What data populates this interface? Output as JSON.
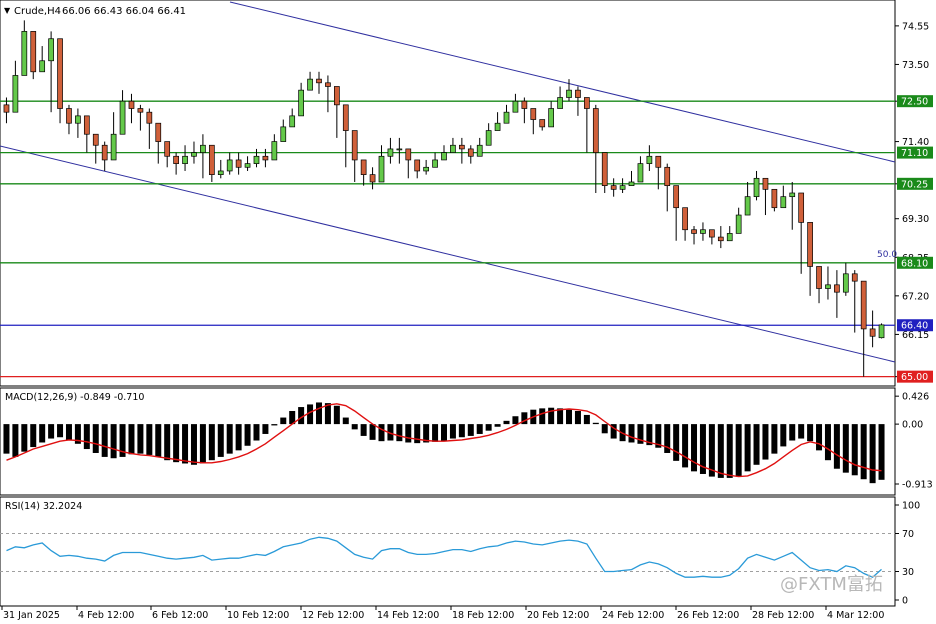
{
  "chart_data": [
    {
      "type": "candlestick",
      "symbol_header": "Crude,H4",
      "ohlc_header": "66.06 66.43 66.04 66.41",
      "y_ticks": [
        "74.55",
        "73.50",
        "72.50",
        "71.40",
        "70.25",
        "69.30",
        "68.25",
        "67.20",
        "66.15",
        "65.00"
      ],
      "ylim": [
        64.8,
        75.2
      ],
      "fib_label": "50.0",
      "h_levels": [
        {
          "value": 72.5,
          "label": "72.50",
          "color": "#1a8a1a"
        },
        {
          "value": 71.1,
          "label": "71.10",
          "color": "#1a8a1a"
        },
        {
          "value": 70.25,
          "label": "70.25",
          "color": "#1a8a1a"
        },
        {
          "value": 68.1,
          "label": "68.10",
          "color": "#1a8a1a"
        },
        {
          "value": 66.4,
          "label": "66.40",
          "color": "#2020c0"
        },
        {
          "value": 65.0,
          "label": "65.00",
          "color": "#e02020"
        }
      ],
      "channel_color": "#3030a0",
      "candles_close": [
        72.2,
        73.2,
        74.4,
        73.3,
        73.6,
        74.2,
        72.3,
        71.9,
        72.1,
        71.6,
        71.3,
        70.9,
        71.6,
        72.5,
        72.3,
        72.2,
        71.9,
        71.4,
        71.0,
        70.8,
        71.0,
        71.1,
        71.3,
        70.5,
        70.6,
        70.9,
        70.7,
        70.8,
        71.0,
        70.9,
        71.4,
        71.8,
        72.1,
        72.8,
        73.1,
        73.0,
        72.9,
        72.4,
        71.7,
        70.9,
        70.5,
        70.3,
        71.0,
        71.2,
        71.2,
        70.9,
        70.6,
        70.7,
        70.9,
        71.1,
        71.3,
        71.2,
        71.0,
        71.3,
        71.7,
        71.9,
        72.2,
        72.5,
        72.3,
        72.0,
        71.8,
        72.3,
        72.6,
        72.8,
        72.6,
        72.3,
        71.1,
        70.2,
        70.1,
        70.2,
        70.3,
        70.8,
        71.0,
        70.7,
        70.2,
        69.6,
        69.0,
        68.9,
        69.0,
        68.8,
        68.7,
        68.9,
        69.4,
        69.9,
        70.4,
        70.1,
        69.6,
        69.9,
        70.0,
        69.2,
        68.0,
        67.4,
        67.5,
        67.3,
        67.8,
        67.6,
        66.3,
        66.1,
        66.41
      ],
      "candles_high": [
        72.6,
        73.6,
        74.7,
        73.9,
        74.0,
        74.4,
        72.6,
        72.4,
        72.3,
        71.8,
        71.5,
        71.4,
        72.2,
        72.8,
        72.7,
        72.4,
        72.3,
        71.7,
        71.3,
        71.1,
        71.3,
        71.4,
        71.6,
        70.9,
        70.9,
        71.1,
        71.1,
        71.0,
        71.2,
        71.2,
        71.6,
        72.0,
        72.3,
        73.0,
        73.3,
        73.3,
        73.2,
        72.7,
        72.0,
        71.3,
        70.8,
        70.7,
        71.3,
        71.5,
        71.5,
        71.2,
        70.9,
        70.9,
        71.1,
        71.3,
        71.5,
        71.5,
        71.3,
        71.5,
        71.9,
        72.2,
        72.4,
        72.7,
        72.6,
        72.3,
        72.0,
        72.5,
        72.9,
        73.1,
        72.9,
        72.6,
        72.4,
        70.6,
        70.4,
        70.4,
        70.6,
        71.0,
        71.3,
        71.0,
        70.8,
        70.0,
        69.3,
        69.1,
        69.2,
        69.0,
        69.1,
        69.1,
        69.6,
        70.3,
        70.6,
        70.4,
        70.0,
        70.2,
        70.3,
        69.5,
        68.4,
        67.7,
        68.0,
        67.9,
        68.1,
        67.9,
        67.0,
        66.8,
        66.45
      ],
      "candles_low": [
        71.9,
        72.7,
        73.2,
        73.1,
        73.3,
        72.2,
        71.9,
        71.6,
        71.5,
        71.1,
        70.8,
        70.6,
        71.3,
        72.2,
        71.9,
        71.7,
        71.2,
        70.8,
        70.7,
        70.5,
        70.6,
        70.8,
        70.4,
        70.3,
        70.4,
        70.5,
        70.5,
        70.6,
        70.7,
        70.7,
        71.2,
        71.5,
        71.9,
        72.6,
        72.8,
        72.7,
        72.2,
        71.5,
        70.7,
        70.3,
        70.2,
        70.1,
        70.8,
        70.8,
        70.8,
        70.4,
        70.4,
        70.5,
        70.7,
        70.9,
        71.1,
        70.8,
        70.8,
        71.1,
        71.5,
        71.7,
        71.9,
        72.2,
        71.9,
        71.6,
        71.7,
        72.1,
        72.5,
        72.5,
        72.1,
        71.1,
        70.0,
        70.0,
        69.9,
        70.0,
        70.2,
        70.6,
        70.6,
        70.1,
        69.5,
        68.7,
        68.7,
        68.6,
        68.7,
        68.6,
        68.5,
        68.7,
        69.2,
        69.8,
        69.8,
        69.4,
        69.5,
        69.8,
        69.0,
        67.8,
        67.2,
        67.0,
        67.1,
        66.6,
        67.2,
        66.2,
        65.0,
        65.8,
        66.04
      ],
      "candles_open": [
        72.4,
        72.2,
        73.2,
        74.4,
        73.3,
        73.6,
        74.2,
        72.3,
        71.9,
        72.1,
        71.6,
        71.3,
        70.9,
        71.6,
        72.5,
        72.3,
        72.2,
        71.9,
        71.4,
        71.0,
        70.8,
        71.0,
        71.1,
        71.3,
        70.5,
        70.6,
        70.9,
        70.7,
        70.8,
        71.0,
        70.9,
        71.4,
        71.8,
        72.1,
        72.8,
        73.1,
        73.0,
        72.9,
        72.4,
        71.7,
        70.9,
        70.5,
        70.3,
        71.0,
        71.2,
        71.2,
        70.9,
        70.6,
        70.7,
        70.9,
        71.1,
        71.3,
        71.2,
        71.0,
        71.3,
        71.7,
        71.9,
        72.2,
        72.5,
        72.3,
        72.0,
        71.8,
        72.3,
        72.6,
        72.8,
        72.6,
        72.3,
        71.1,
        70.2,
        70.1,
        70.2,
        70.3,
        70.8,
        71.0,
        70.7,
        70.2,
        69.6,
        69.0,
        68.9,
        69.0,
        68.8,
        68.7,
        68.9,
        69.4,
        69.9,
        70.4,
        70.1,
        69.6,
        69.9,
        70.0,
        69.2,
        68.0,
        67.4,
        67.5,
        67.3,
        67.8,
        67.6,
        66.3,
        66.06
      ]
    },
    {
      "type": "bar",
      "title": "MACD(12,26,9) -0.849 -0.710",
      "y_ticks": [
        "0.426",
        "0.00",
        "-0.913"
      ],
      "ylim": [
        -1.05,
        0.52
      ],
      "histogram": [
        -0.45,
        -0.5,
        -0.42,
        -0.35,
        -0.28,
        -0.22,
        -0.2,
        -0.25,
        -0.3,
        -0.38,
        -0.44,
        -0.5,
        -0.52,
        -0.5,
        -0.46,
        -0.45,
        -0.47,
        -0.5,
        -0.55,
        -0.58,
        -0.6,
        -0.62,
        -0.6,
        -0.55,
        -0.5,
        -0.45,
        -0.4,
        -0.33,
        -0.25,
        -0.15,
        -0.02,
        0.1,
        0.2,
        0.26,
        0.3,
        0.33,
        0.32,
        0.28,
        0.1,
        -0.08,
        -0.18,
        -0.24,
        -0.26,
        -0.25,
        -0.26,
        -0.28,
        -0.29,
        -0.28,
        -0.27,
        -0.25,
        -0.22,
        -0.2,
        -0.18,
        -0.15,
        -0.1,
        -0.04,
        0.05,
        0.12,
        0.18,
        0.22,
        0.24,
        0.25,
        0.24,
        0.22,
        0.2,
        0.14,
        0.02,
        -0.14,
        -0.22,
        -0.26,
        -0.28,
        -0.3,
        -0.32,
        -0.36,
        -0.44,
        -0.56,
        -0.66,
        -0.72,
        -0.76,
        -0.8,
        -0.82,
        -0.82,
        -0.8,
        -0.72,
        -0.62,
        -0.54,
        -0.45,
        -0.34,
        -0.25,
        -0.22,
        -0.26,
        -0.4,
        -0.55,
        -0.68,
        -0.74,
        -0.78,
        -0.84,
        -0.9,
        -0.849
      ],
      "signal": [
        -0.55,
        -0.5,
        -0.44,
        -0.38,
        -0.34,
        -0.3,
        -0.26,
        -0.24,
        -0.25,
        -0.27,
        -0.3,
        -0.34,
        -0.38,
        -0.42,
        -0.45,
        -0.47,
        -0.48,
        -0.5,
        -0.52,
        -0.54,
        -0.56,
        -0.58,
        -0.59,
        -0.59,
        -0.57,
        -0.54,
        -0.5,
        -0.45,
        -0.38,
        -0.3,
        -0.2,
        -0.1,
        0.0,
        0.1,
        0.18,
        0.24,
        0.29,
        0.31,
        0.28,
        0.2,
        0.1,
        0.0,
        -0.08,
        -0.14,
        -0.18,
        -0.21,
        -0.23,
        -0.25,
        -0.26,
        -0.26,
        -0.25,
        -0.24,
        -0.22,
        -0.2,
        -0.17,
        -0.13,
        -0.08,
        -0.02,
        0.05,
        0.11,
        0.16,
        0.2,
        0.22,
        0.23,
        0.22,
        0.2,
        0.14,
        0.04,
        -0.06,
        -0.14,
        -0.2,
        -0.24,
        -0.28,
        -0.31,
        -0.35,
        -0.42,
        -0.5,
        -0.58,
        -0.65,
        -0.7,
        -0.75,
        -0.78,
        -0.8,
        -0.79,
        -0.74,
        -0.68,
        -0.6,
        -0.5,
        -0.4,
        -0.31,
        -0.27,
        -0.3,
        -0.38,
        -0.47,
        -0.55,
        -0.62,
        -0.66,
        -0.7,
        -0.71
      ]
    },
    {
      "type": "line",
      "title": "RSI(14) 32.2024",
      "y_ticks": [
        "100",
        "70",
        "30",
        "0"
      ],
      "ylim": [
        0,
        100
      ],
      "values": [
        52,
        56,
        55,
        58,
        60,
        52,
        46,
        47,
        46,
        44,
        43,
        41,
        47,
        50,
        50,
        50,
        48,
        46,
        44,
        43,
        44,
        45,
        47,
        42,
        43,
        44,
        44,
        46,
        48,
        47,
        51,
        56,
        58,
        60,
        64,
        66,
        65,
        62,
        55,
        48,
        45,
        43,
        52,
        54,
        54,
        50,
        48,
        48,
        49,
        51,
        53,
        53,
        51,
        54,
        56,
        57,
        60,
        62,
        61,
        59,
        58,
        60,
        62,
        63,
        62,
        59,
        44,
        30,
        30,
        31,
        32,
        37,
        40,
        38,
        34,
        28,
        24,
        24,
        25,
        24,
        24,
        26,
        33,
        44,
        48,
        45,
        42,
        46,
        50,
        42,
        34,
        31,
        32,
        30,
        36,
        34,
        28,
        24,
        32.2
      ]
    }
  ],
  "x_labels": [
    "31 Jan 2025",
    "4 Feb 12:00",
    "6 Feb 12:00",
    "10 Feb 12:00",
    "12 Feb 12:00",
    "14 Feb 12:00",
    "18 Feb 12:00",
    "20 Feb 12:00",
    "24 Feb 12:00",
    "26 Feb 12:00",
    "28 Feb 12:00",
    "4 Mar 12:00"
  ],
  "watermark": "@FXTM富拓",
  "colors": {
    "bull": "#64c94a",
    "bear": "#d0603a",
    "macd_hist": "#000000",
    "macd_signal": "#e01010",
    "rsi": "#2a9ad8",
    "grid_dash": "#a0a0a0"
  }
}
